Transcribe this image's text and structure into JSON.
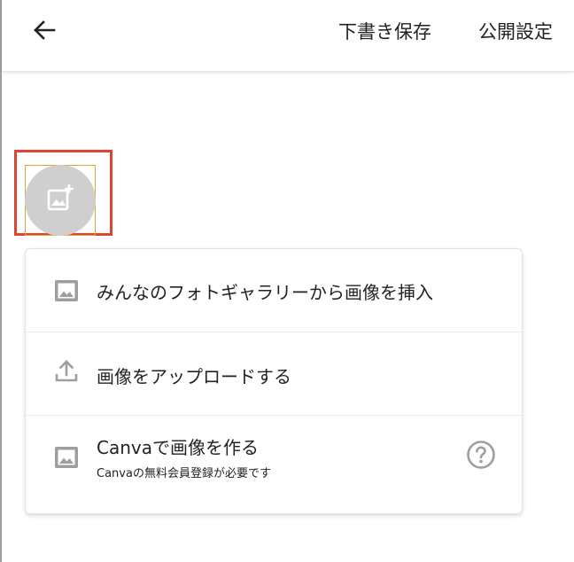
{
  "header": {
    "save_draft_label": "下書き保存",
    "publish_settings_label": "公開設定"
  },
  "image_menu": {
    "items": [
      {
        "label": "みんなのフォトギャラリーから画像を挿入",
        "icon": "image-icon"
      },
      {
        "label": "画像をアップロードする",
        "icon": "upload-icon"
      },
      {
        "label": "Canvaで画像を作る",
        "sublabel": "Canvaの無料会員登録が必要です",
        "icon": "image-icon",
        "help_icon": "help-circle-icon"
      }
    ]
  },
  "icons": {
    "back": "arrow-left-icon",
    "add_image": "add-photo-icon"
  },
  "colors": {
    "highlight_border": "#e0442f",
    "frame_border": "#e3a43a",
    "add_button_bg": "#cfcfcf",
    "icon_gray": "#9e9e9e"
  }
}
